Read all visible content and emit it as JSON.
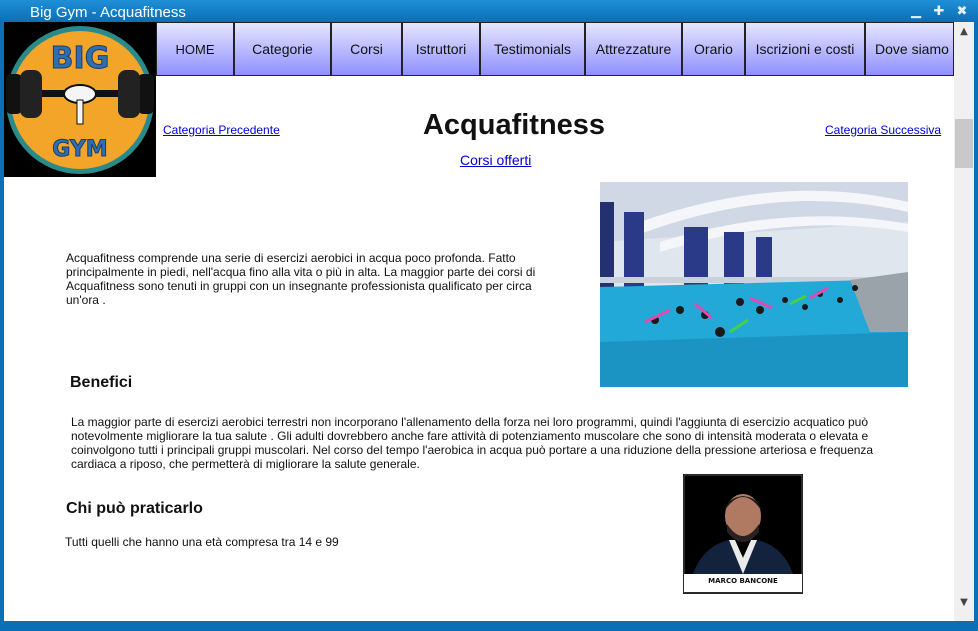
{
  "window": {
    "title": "Big Gym - Acquafitness"
  },
  "logo": {
    "text": "BIG GYM"
  },
  "nav": [
    {
      "label": "HOME"
    },
    {
      "label": "Categorie"
    },
    {
      "label": "Corsi"
    },
    {
      "label": "Istruttori"
    },
    {
      "label": "Testimonials"
    },
    {
      "label": "Attrezzature"
    },
    {
      "label": "Orario"
    },
    {
      "label": "Iscrizioni e costi"
    },
    {
      "label": "Dove siamo"
    }
  ],
  "page": {
    "prev_label": "Categoria Precedente",
    "next_label": "Categoria Successiva",
    "title": "Acquafitness",
    "courses_link": "Corsi offerti",
    "intro": "Acquafitness comprende una serie di esercizi aerobici in acqua poco profonda. Fatto principalmente in piedi, nell'acqua fino alla vita o più in alta. La maggior parte dei corsi di Acquafitness sono tenuti in gruppi con un insegnante professionista qualificato per circa un'ora .",
    "benefits_heading": "Benefici",
    "benefits_text": "La maggior parte di esercizi aerobici terrestri non incorporano l'allenamento della forza nei loro programmi, quindi l'aggiunta di esercizio acquatico può notevolmente migliorare la tua salute . Gli adulti dovrebbero anche fare attività di potenziamento muscolare che sono di intensità moderata o elevata e coinvolgono tutti i principali gruppi muscolari. Nel corso del tempo l'aerobica in acqua può portare a una riduzione della pressione arteriosa e frequenza cardiaca a riposo, che permetterà di migliorare la salute generale.",
    "who_heading": "Chi può praticarlo",
    "who_text": "Tutti quelli che hanno una età compresa tra 14 e 99",
    "instructor_name": "MARCO BANCONE"
  },
  "colors": {
    "titlebar": "#0b6fb6",
    "nav_gradient_top": "#e6e6ff",
    "nav_gradient_bottom": "#8f8fff",
    "link": "#0000cc",
    "logo_orange": "#f3a52a",
    "logo_teal": "#2a8a8a"
  }
}
